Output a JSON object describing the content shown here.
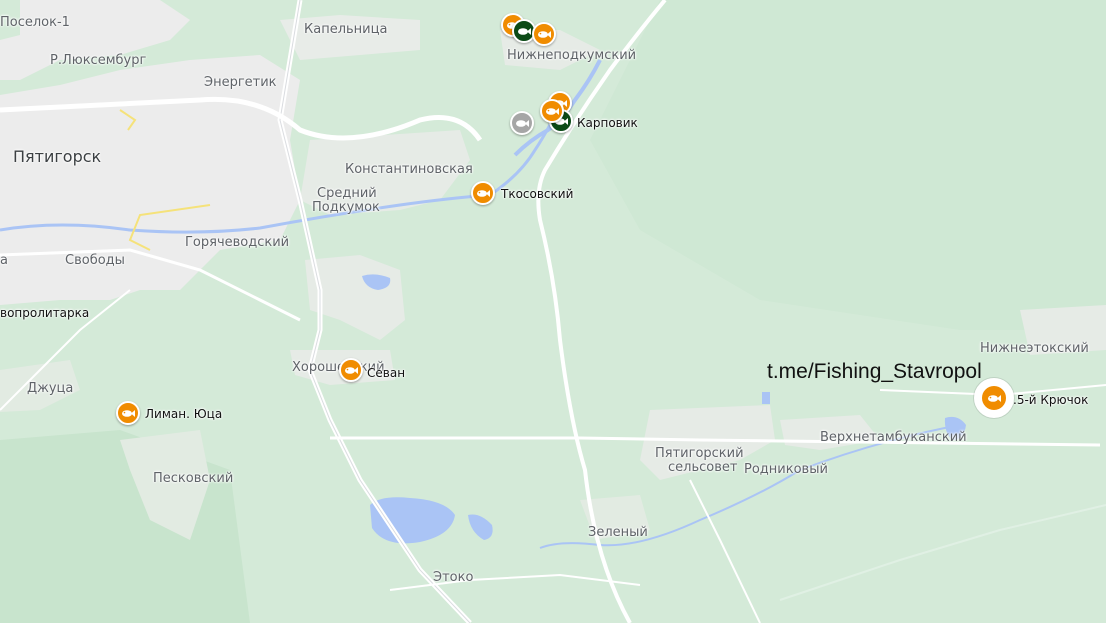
{
  "watermark": "t.me/Fishing_Stavropol",
  "places": {
    "poselok1": "Поселок-1",
    "kapelnitsa": "Капельница",
    "luxemburg": "Р.Люксембург",
    "energetik": "Энергетик",
    "nizhnepodkumsky": "Нижнеподкумский",
    "pyatigorsk": "Пятигорск",
    "konstantinovskaya": "Константиновская",
    "sredniy": "Средний",
    "podkumok": "Подкумок",
    "goryachevodsky": "Горячеводский",
    "svobody": "Свободы",
    "novoproletarka": "вопролитарка",
    "khoroshevsky": "Хорошевский",
    "dzhutsa": "Джуца",
    "peskovsky": "Песковский",
    "nizhneetoksky": "Нижнеэтокский",
    "verkhnetambukansky": "Верхнетамбуканский",
    "pyatigorsky": "Пятигорский",
    "selsovet": "сельсовет",
    "rodnikovy": "Родниковый",
    "zeleny": "Зеленый",
    "etoko": "Этоко",
    "a": "а"
  },
  "spots": {
    "karpovik": "Карповик",
    "tkosovsky": "Ткосовский",
    "sevan": "Севан",
    "liman": "Лиман. Юца",
    "kryuchok": ".5-й Крючок"
  },
  "colors": {
    "land": "#d4ead8",
    "urban": "#ececec",
    "water": "#aac4f5",
    "spot_orange": "#f08c00",
    "spot_dark": "#0b4a16",
    "spot_grey": "#a6a6a6"
  },
  "icons": {
    "spot_marker": "fish-icon"
  }
}
